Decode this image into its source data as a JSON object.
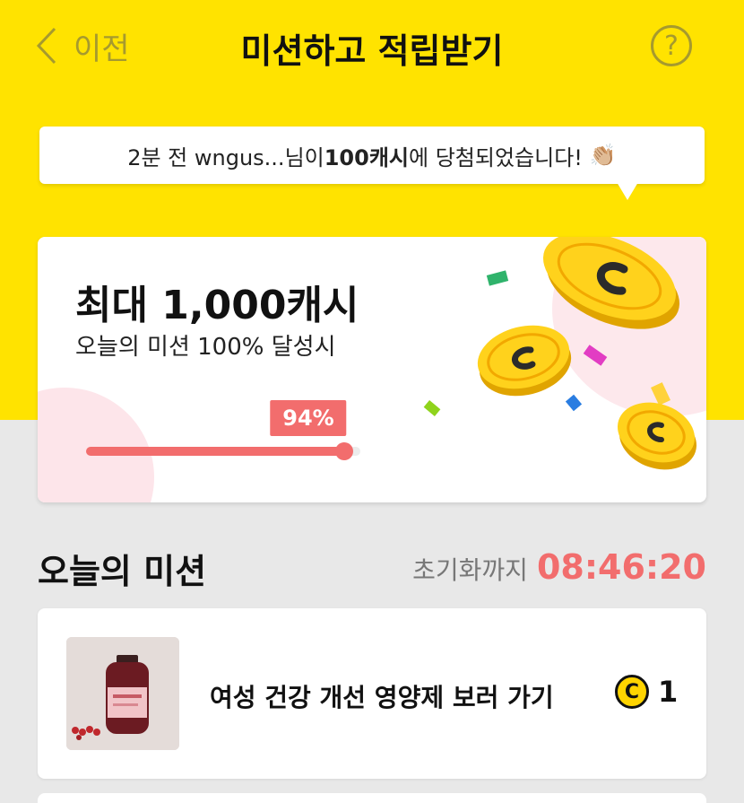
{
  "header": {
    "back_label": "이전",
    "title": "미션하고 적립받기",
    "help_symbol": "?"
  },
  "notice": {
    "prefix": "2분 전 wngus...님이 ",
    "highlight": "100캐시",
    "suffix": "에 당첨되었습니다!",
    "emoji": "👏🏼"
  },
  "hero": {
    "title": "최대 1,000캐시",
    "subtitle": "오늘의 미션 100% 달성시",
    "progress_label": "94%",
    "progress_value": 0.94
  },
  "missions": {
    "section_title": "오늘의 미션",
    "reset_label": "초기화까지",
    "reset_time": "08:46:20",
    "items": [
      {
        "text": "여성 건강 개선 영양제 보러 가기",
        "reward_icon": "C",
        "reward": "1"
      }
    ]
  },
  "colors": {
    "brand_yellow": "#ffe300",
    "accent_red": "#f26d6d",
    "coin_gold": "#ffd400"
  }
}
